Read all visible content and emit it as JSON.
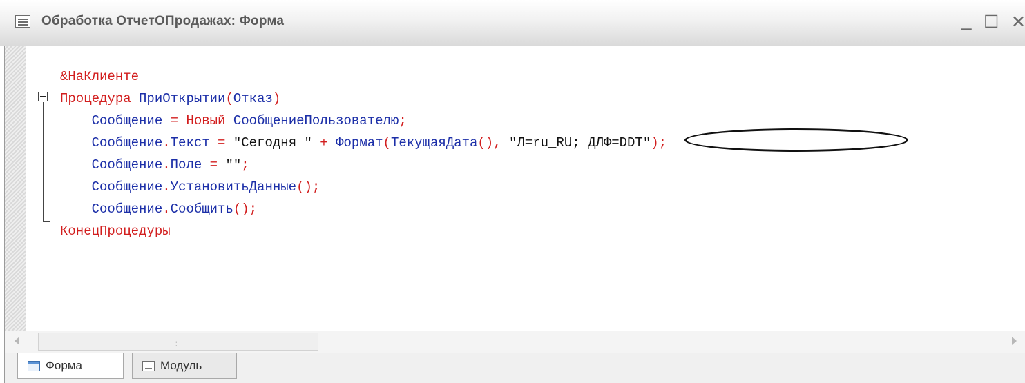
{
  "window": {
    "title": "Обработка ОтчетОПродажах: Форма",
    "minimize_glyph": "_",
    "maximize_glyph": "☐",
    "close_glyph": "✕",
    "icon": "form-window-icon"
  },
  "code": {
    "lines": [
      {
        "directive": "&НаКлиенте"
      },
      {
        "kw": "Процедура",
        "name": "ПриОткрытии",
        "open": "(",
        "param": "Отказ",
        "close": ")"
      },
      {
        "indent": "    ",
        "lhs": "Сообщение",
        "eq": " = ",
        "kw": "Новый",
        "type": "СообщениеПользователю",
        "semi": ";"
      },
      {
        "indent": "    ",
        "obj": "Сообщение",
        "dot": ".",
        "prop": "Текст",
        "eq": " = ",
        "str1": "\"Сегодня \"",
        "plus": " + ",
        "fn": "Формат",
        "open": "(",
        "fn2": "ТекущаяДата",
        "call": "()",
        "comma": ", ",
        "str2": "\"Л=ru_RU; ДЛФ=DDT\"",
        "close": ")",
        "semi": ";"
      },
      {
        "indent": "    ",
        "obj": "Сообщение",
        "dot": ".",
        "prop": "Поле",
        "eq": " = ",
        "str": "\"\"",
        "semi": ";"
      },
      {
        "indent": "    ",
        "obj": "Сообщение",
        "dot": ".",
        "method": "УстановитьДанные",
        "call": "()",
        "semi": ";"
      },
      {
        "indent": "    ",
        "obj": "Сообщение",
        "dot": ".",
        "method": "Сообщить",
        "call": "()",
        "semi": ";"
      },
      {
        "kw": "КонецПроцедуры"
      }
    ]
  },
  "tabs": [
    {
      "label": "Форма",
      "icon": "form-icon",
      "active": true
    },
    {
      "label": "Модуль",
      "icon": "module-icon",
      "active": false
    }
  ],
  "colors": {
    "keyword": "#d21e1e",
    "identifier": "#1c2fa8",
    "string": "#111111"
  }
}
